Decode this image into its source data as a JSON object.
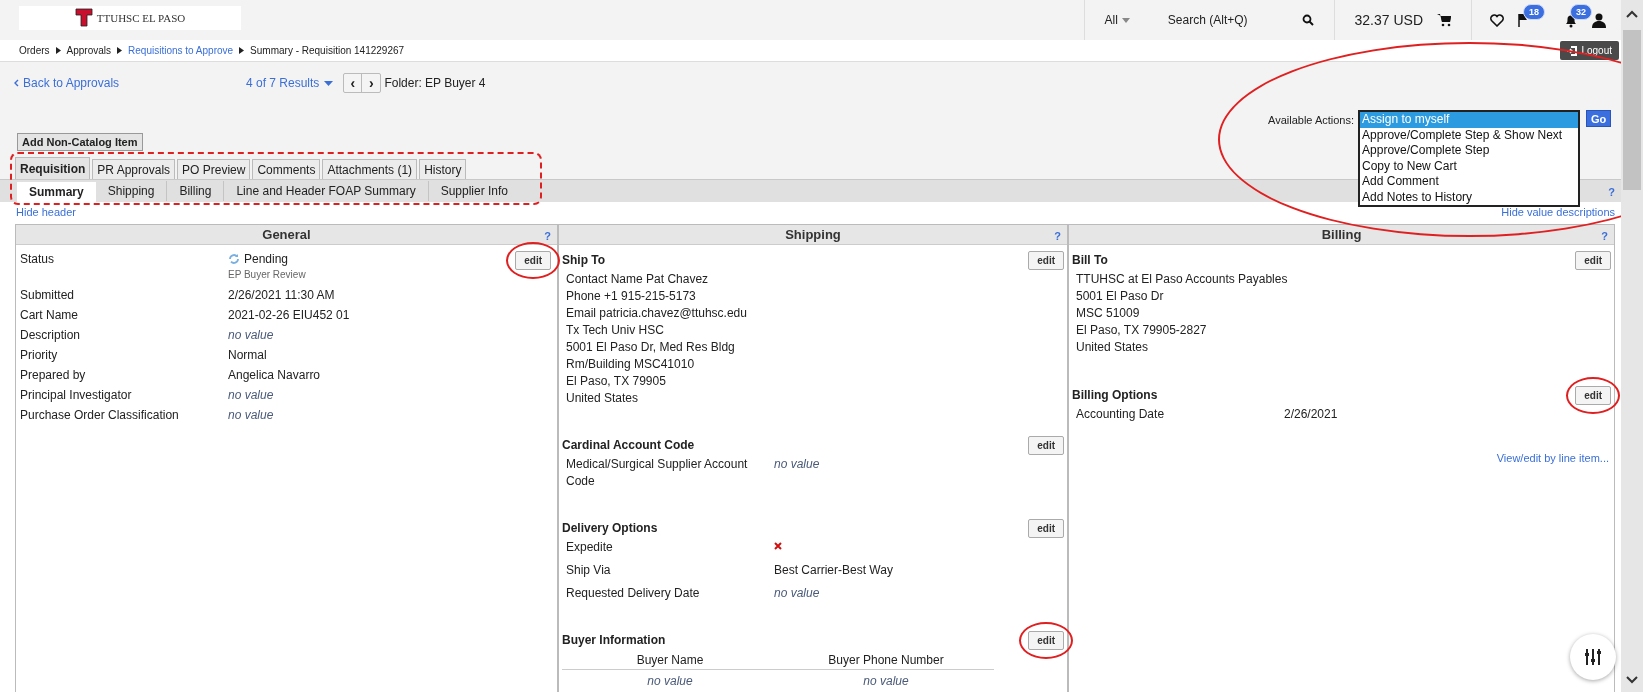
{
  "header": {
    "logo_text": "TTUHSC EL PASO",
    "search_scope": "All",
    "search_placeholder": "Search (Alt+Q)",
    "cart_total": "32.37 USD",
    "flag_count": "18",
    "notification_count": "32"
  },
  "breadcrumb": [
    {
      "label": "Orders",
      "link": false
    },
    {
      "label": "Approvals",
      "link": false
    },
    {
      "label": "Requisitions to Approve",
      "link": true
    },
    {
      "label": "Summary - Requisition 141229267",
      "link": false
    }
  ],
  "logout": "Logout",
  "nav": {
    "back": "Back to Approvals",
    "results": "4 of 7 Results",
    "prev": "‹",
    "next": "›",
    "folder": "Folder: EP Buyer 4"
  },
  "actions": {
    "label": "Available Actions:",
    "circled": true,
    "go": "Go",
    "options": [
      {
        "label": "Assign to myself",
        "selected": true
      },
      {
        "label": "Approve/Complete Step & Show Next",
        "selected": false
      },
      {
        "label": "Approve/Complete Step",
        "selected": false
      },
      {
        "label": "Copy to New Cart",
        "selected": false
      },
      {
        "label": "Add Comment",
        "selected": false
      },
      {
        "label": "Add Notes to History",
        "selected": false
      }
    ]
  },
  "add_button": "Add Non-Catalog Item",
  "tabs_circled": true,
  "tabs": [
    {
      "label": "Requisition",
      "selected": true
    },
    {
      "label": "PR Approvals",
      "selected": false
    },
    {
      "label": "PO Preview",
      "selected": false
    },
    {
      "label": "Comments",
      "selected": false
    },
    {
      "label": "Attachments (1)",
      "selected": false
    },
    {
      "label": "History",
      "selected": false
    }
  ],
  "subtabs": [
    {
      "label": "Summary",
      "selected": true
    },
    {
      "label": "Shipping",
      "selected": false
    },
    {
      "label": "Billing",
      "selected": false
    },
    {
      "label": "Line and Header FOAP Summary",
      "selected": false
    },
    {
      "label": "Supplier Info",
      "selected": false
    }
  ],
  "subtabs_help": "?",
  "hide_header": "Hide header",
  "hide_values": "Hide value descriptions",
  "general": {
    "title": "General",
    "help": "?",
    "edit": {
      "label": "edit",
      "circled": true
    },
    "rows": [
      {
        "kind": "status",
        "label": "Status",
        "value": "Pending",
        "sub": "EP Buyer Review"
      },
      {
        "kind": "text",
        "label": "Submitted",
        "value": "2/26/2021 11:30 AM"
      },
      {
        "kind": "text",
        "label": "Cart Name",
        "value": "2021-02-26 EIU452 01"
      },
      {
        "kind": "empty",
        "label": "Description",
        "value": "no value"
      },
      {
        "kind": "text",
        "label": "Priority",
        "value": "Normal"
      },
      {
        "kind": "text",
        "label": "Prepared by",
        "value": "Angelica Navarro"
      },
      {
        "kind": "empty",
        "label": "Principal Investigator",
        "value": "no value"
      },
      {
        "kind": "empty",
        "label": "Purchase Order Classification",
        "value": "no value"
      }
    ]
  },
  "shipping": {
    "title": "Shipping",
    "help": "?",
    "sections": [
      {
        "kind": "lines",
        "title": "Ship To",
        "edit": {
          "label": "edit",
          "circled": false
        },
        "lines": [
          "Contact Name Pat Chavez",
          "Phone +1 915-215-5173",
          "Email patricia.chavez@ttuhsc.edu",
          "Tx Tech Univ HSC",
          "5001 El Paso Dr, Med Res Bldg",
          "Rm/Building MSC41010",
          "El Paso, TX 79905",
          "United States"
        ]
      },
      {
        "kind": "fields",
        "title": "Cardinal Account Code",
        "edit": {
          "label": "edit",
          "circled": false
        },
        "rows": [
          {
            "kind": "empty",
            "label": "Medical/Surgical Supplier Account Code",
            "value": "no value"
          }
        ]
      },
      {
        "kind": "fields",
        "title": "Delivery Options",
        "edit": {
          "label": "edit",
          "circled": false
        },
        "rows": [
          {
            "kind": "flag",
            "label": "Expedite",
            "checked": false
          },
          {
            "kind": "text",
            "label": "Ship Via",
            "value": "Best Carrier-Best Way"
          },
          {
            "kind": "empty",
            "label": "Requested Delivery Date",
            "value": "no value"
          }
        ]
      },
      {
        "kind": "table",
        "title": "Buyer Information",
        "edit": {
          "label": "edit",
          "circled": true
        },
        "columns": [
          "Buyer Name",
          "Buyer Phone Number"
        ],
        "cells": [
          "no value",
          "no value"
        ]
      }
    ]
  },
  "billing": {
    "title": "Billing",
    "help": "?",
    "sections": [
      {
        "kind": "lines",
        "title": "Bill To",
        "edit": {
          "label": "edit",
          "circled": false
        },
        "lines": [
          "TTUHSC at El Paso Accounts Payables",
          "5001 El Paso Dr",
          "MSC 51009",
          "El Paso, TX 79905-2827",
          "United States"
        ]
      },
      {
        "kind": "fields",
        "title": "Billing Options",
        "edit": {
          "label": "edit",
          "circled": true
        },
        "rows": [
          {
            "kind": "text",
            "label": "Accounting Date",
            "value": "2/26/2021"
          }
        ]
      }
    ],
    "link": "View/edit by line item..."
  }
}
